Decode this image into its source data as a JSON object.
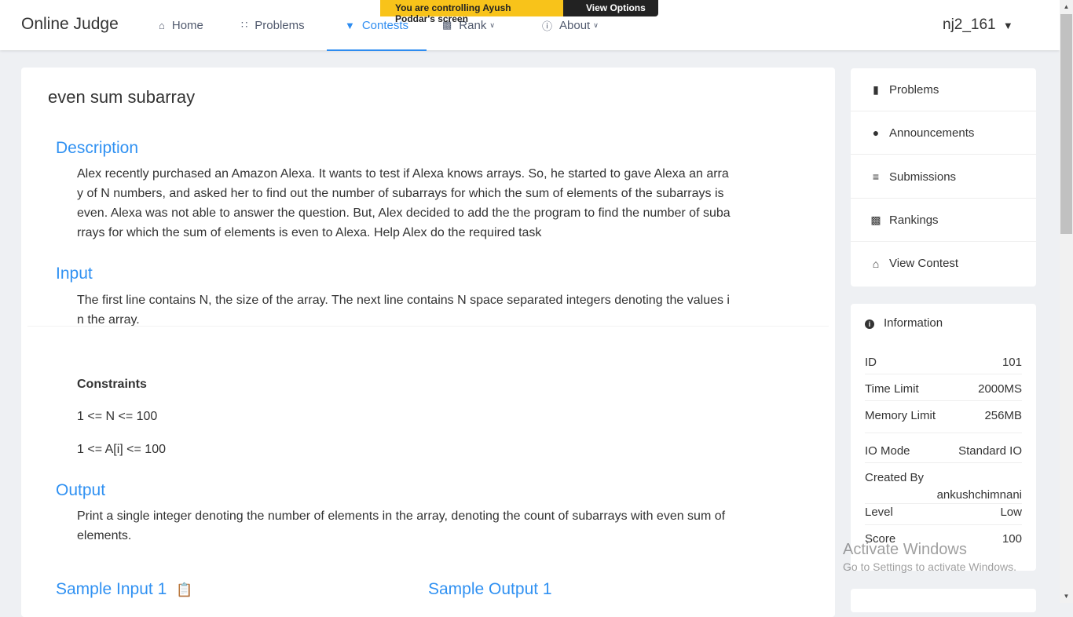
{
  "navbar": {
    "brand": "Online Judge",
    "items": [
      {
        "label": "Home",
        "icon": "home-icon"
      },
      {
        "label": "Problems",
        "icon": "grid-icon"
      },
      {
        "label": "Contests",
        "icon": "trophy-icon"
      },
      {
        "label": "Rank",
        "icon": "bar-chart-icon"
      },
      {
        "label": "About",
        "icon": "info-icon"
      }
    ],
    "active": "Contests",
    "user": "nj2_161"
  },
  "share_banner": {
    "message": "You are controlling Ayush Poddar's screen",
    "options_label": "View Options"
  },
  "problem": {
    "title": "even sum subarray",
    "description_heading": "Description",
    "description_lines": [
      "Alex recently purchased an Amazon Alexa. It wants to test if Alexa knows arrays. So, he started to gave Alexa an arra",
      "y of N numbers, and asked her to find out the number of subarrays for which the sum of elements of the subarrays is",
      "even. Alexa was not able to answer the question. But, Alex decided to add the the program to find the number of suba",
      "rrays for which the sum of elements is even to Alexa. Help Alex do the required task"
    ],
    "input_heading": "Input",
    "input_lines": [
      "The first line contains N, the size of the array. The next line contains N space separated integers denoting the values i",
      "n the array."
    ],
    "constraints_heading": "Constraints",
    "constraint_1": "1 <= N <= 100",
    "constraint_2": "1 <= A[i] <= 100",
    "output_heading": "Output",
    "output_lines": [
      "Print a single integer denoting the number of elements in the array, denoting the count of subarrays with even sum of",
      "elements."
    ],
    "sample_input_heading": "Sample Input 1",
    "sample_output_heading": "Sample Output 1"
  },
  "sidebar": {
    "menu": [
      {
        "label": "Problems",
        "icon": "book-icon"
      },
      {
        "label": "Announcements",
        "icon": "chat-icon"
      },
      {
        "label": "Submissions",
        "icon": "list-icon"
      },
      {
        "label": "Rankings",
        "icon": "bar-chart-icon"
      },
      {
        "label": "View Contest",
        "icon": "home-icon"
      }
    ],
    "info": {
      "heading": "Information",
      "id_label": "ID",
      "id_value": "101",
      "time_label": "Time Limit",
      "time_value": "2000MS",
      "memory_label": "Memory Limit",
      "memory_value": "256MB",
      "io_label": "IO Mode",
      "io_value": "Standard IO",
      "created_label": "Created By",
      "created_value": "ankushchimnani",
      "level_label": "Level",
      "level_value": "Low",
      "score_label": "Score",
      "score_value": "100"
    }
  },
  "watermark": {
    "line1": "Activate Windows",
    "line2": "Go to Settings to activate Windows."
  }
}
